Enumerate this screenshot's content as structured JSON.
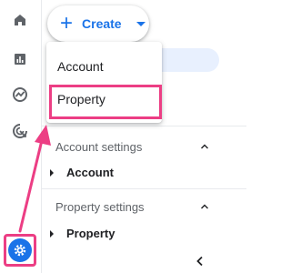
{
  "create_button": {
    "label": "Create"
  },
  "create_menu": {
    "items": [
      {
        "label": "Account"
      },
      {
        "label": "Property"
      }
    ]
  },
  "sidebar": {
    "sections": [
      {
        "title": "Account settings",
        "item": "Account"
      },
      {
        "title": "Property settings",
        "item": "Property"
      }
    ]
  },
  "rail_icons": [
    "home-icon",
    "reports-icon",
    "explore-icon",
    "advertising-icon",
    "settings-icon"
  ],
  "colors": {
    "accent": "#1a73e8",
    "annotation": "#ec3e84",
    "selected_bg": "#e8f0fe"
  }
}
